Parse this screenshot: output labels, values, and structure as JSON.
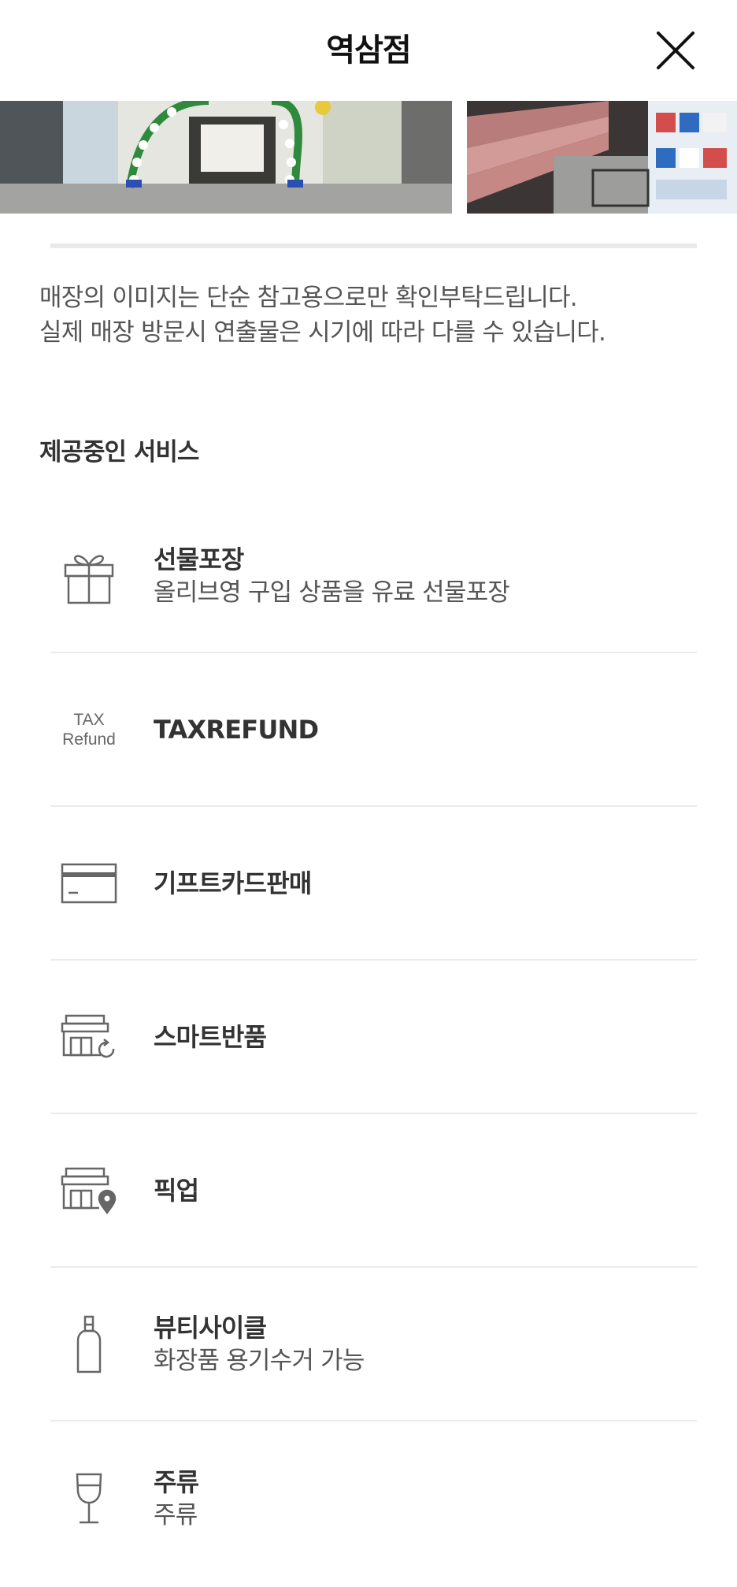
{
  "header": {
    "title": "역삼점"
  },
  "notice": {
    "line1": "매장의 이미지는 단순 참고용으로만 확인부탁드립니다.",
    "line2": "실제 매장 방문시 연출물은 시기에 따라 다를 수 있습니다."
  },
  "services": {
    "title": "제공중인 서비스",
    "items": [
      {
        "icon": "gift-icon",
        "name": "선물포장",
        "desc": "올리브영 구입 상품을 유료 선물포장"
      },
      {
        "icon": "tax-refund-icon",
        "icon_text_1": "TAX",
        "icon_text_2": "Refund",
        "name": "TAXREFUND",
        "desc": ""
      },
      {
        "icon": "card-icon",
        "name": "기프트카드판매",
        "desc": ""
      },
      {
        "icon": "store-return-icon",
        "name": "스마트반품",
        "desc": ""
      },
      {
        "icon": "store-pin-icon",
        "name": "픽업",
        "desc": ""
      },
      {
        "icon": "bottle-icon",
        "name": "뷰티사이클",
        "desc": "화장품 용기수거 가능"
      },
      {
        "icon": "wine-glass-icon",
        "name": "주류",
        "desc": "주류"
      }
    ]
  },
  "colors": {
    "divider": "#ebebeb",
    "text": "#333333",
    "subtext": "#555555"
  }
}
